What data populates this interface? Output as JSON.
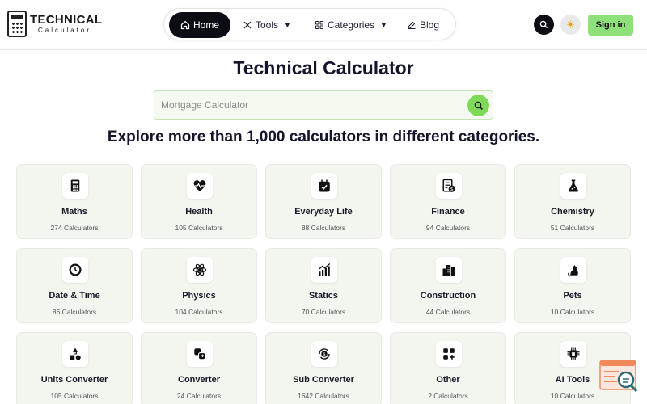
{
  "header": {
    "logo_title": "TECHNICAL",
    "logo_subtitle": "Calculator",
    "nav": [
      {
        "label": "Home",
        "icon": "home-icon",
        "active": true
      },
      {
        "label": "Tools",
        "icon": "tools-icon",
        "dropdown": true
      },
      {
        "label": "Categories",
        "icon": "grid-icon",
        "dropdown": true
      },
      {
        "label": "Blog",
        "icon": "edit-icon"
      }
    ],
    "sign_in": "Sign in",
    "accent": "#8ee07a"
  },
  "main": {
    "title": "Technical Calculator",
    "search_placeholder": "Mortgage Calculator",
    "subtitle": "Explore more than 1,000 calculators in different categories."
  },
  "categories": [
    {
      "name": "Maths",
      "count": "274 Calculators",
      "icon": "calculator-icon"
    },
    {
      "name": "Health",
      "count": "105 Calculators",
      "icon": "heartbeat-icon"
    },
    {
      "name": "Everyday Life",
      "count": "88 Calculators",
      "icon": "calendar-check-icon"
    },
    {
      "name": "Finance",
      "count": "94 Calculators",
      "icon": "invoice-dollar-icon"
    },
    {
      "name": "Chemistry",
      "count": "51 Calculators",
      "icon": "flask-icon"
    },
    {
      "name": "Date & Time",
      "count": "86 Calculators",
      "icon": "clock-icon"
    },
    {
      "name": "Physics",
      "count": "104 Calculators",
      "icon": "atom-icon"
    },
    {
      "name": "Statics",
      "count": "70 Calculators",
      "icon": "bar-chart-icon"
    },
    {
      "name": "Construction",
      "count": "44 Calculators",
      "icon": "buildings-icon"
    },
    {
      "name": "Pets",
      "count": "10 Calculators",
      "icon": "pet-icon"
    },
    {
      "name": "Units Converter",
      "count": "105 Calculators",
      "icon": "units-icon"
    },
    {
      "name": "Converter",
      "count": "24 Calculators",
      "icon": "convert-icon"
    },
    {
      "name": "Sub Converter",
      "count": "1642 Calculators",
      "icon": "coin-cycle-icon"
    },
    {
      "name": "Other",
      "count": "2 Calculators",
      "icon": "apps-plus-icon"
    },
    {
      "name": "AI Tools",
      "count": "10 Calculators",
      "icon": "chip-icon"
    }
  ]
}
